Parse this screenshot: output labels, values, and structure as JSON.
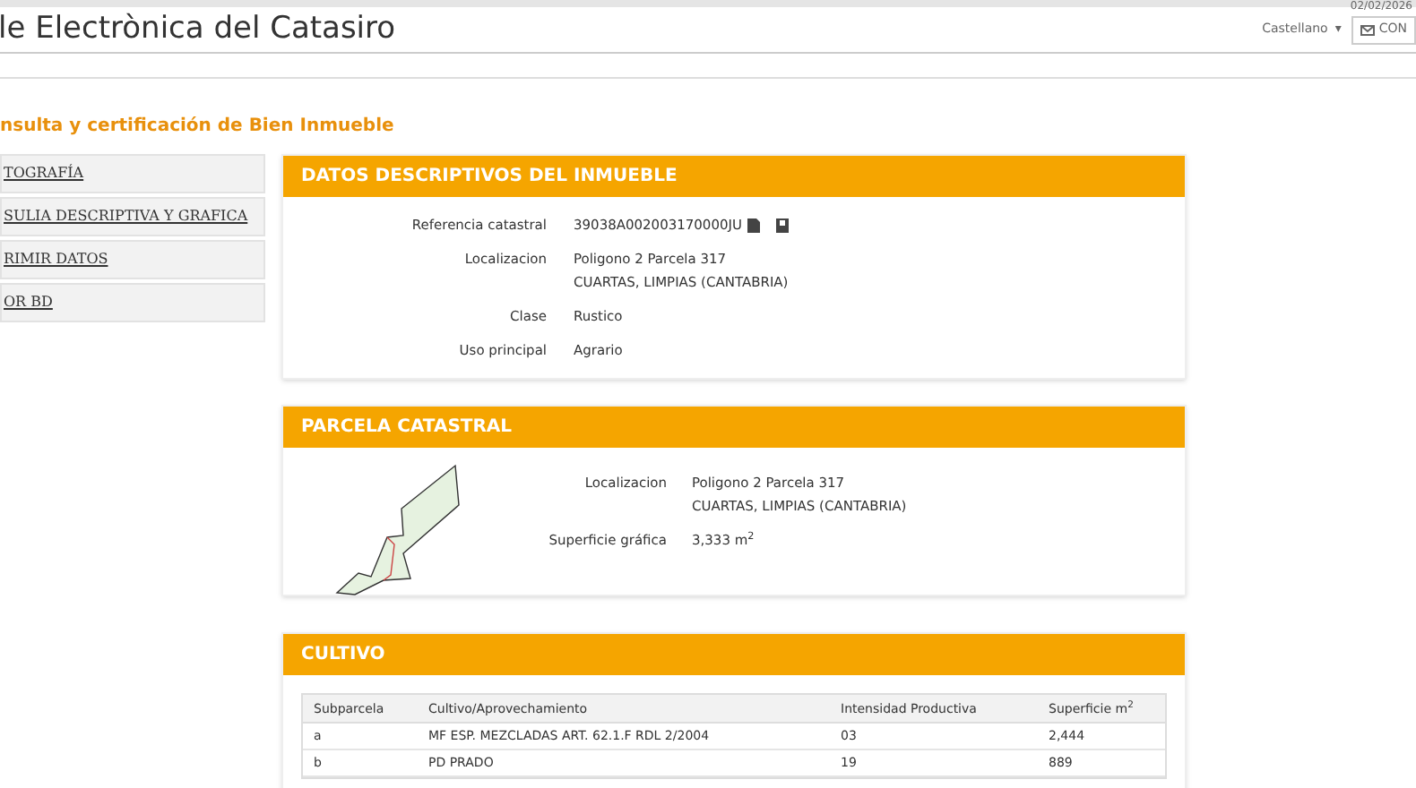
{
  "top_bar": {
    "date": "02/02/2026",
    "language": "Castellano",
    "language_caret": "▾",
    "contact_button": "CON"
  },
  "header": {
    "title": "le Electrònica del Catasiro"
  },
  "page_subtitle": "nsulta y certificación de Bien Inmueble",
  "sidebar": {
    "items": [
      {
        "label": "TOGRAFÍA"
      },
      {
        "label": "SULIA DESCRIPTIVA Y GRAFICA"
      },
      {
        "label": "RIMIR DATOS"
      },
      {
        "label": "OR BD"
      }
    ]
  },
  "datos_descriptivos": {
    "title": "DATOS DESCRIPTIVOS DEL INMUEBLE",
    "fields": [
      {
        "label": "Referencia catastral",
        "lines": [
          "39038A002003170000JU"
        ],
        "icons": true
      },
      {
        "label": "Localizacion",
        "lines": [
          "Poligono 2 Parcela 317",
          "CUARTAS, LIMPIAS (CANTABRIA)"
        ],
        "icons": false
      },
      {
        "label": "Clase",
        "lines": [
          "Rustico"
        ],
        "icons": false
      },
      {
        "label": "Uso principal",
        "lines": [
          "Agrario"
        ],
        "icons": false
      }
    ]
  },
  "parcela": {
    "title": "PARCELA CATASTRAL",
    "fields": [
      {
        "label": "Localizacion",
        "lines": [
          "Poligono 2 Parcela 317",
          "CUARTAS, LIMPIAS (CANTABRIA)"
        ]
      },
      {
        "label": "Superficie gráfica",
        "lines": [
          "3,333 m$^{2}$"
        ]
      }
    ]
  },
  "cultivo": {
    "title": "CULTIVO",
    "table": {
      "columns": [
        "Subparcela",
        "Cultivo/Aprovechamiento",
        "Intensidad Productiva",
        "Superficie m$^{2}$"
      ],
      "rows": [
        [
          "a",
          "MF ESP. MEZCLADAS ART. 62.1.F RDL 2/2004",
          "03",
          "2,444"
        ],
        [
          "b",
          "PD PRADO",
          "19",
          "889"
        ]
      ]
    }
  }
}
